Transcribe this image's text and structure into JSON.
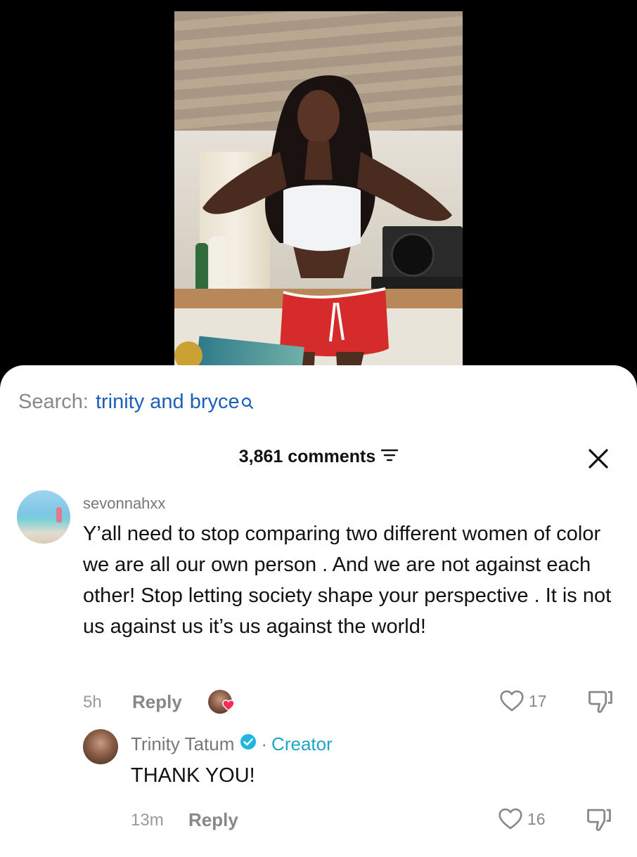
{
  "search": {
    "prefix": "Search:",
    "term": "trinity and bryce"
  },
  "comments_header": {
    "count_label": "3,861 comments"
  },
  "comments": [
    {
      "username": "sevonnahxx",
      "text": "Y’all need to stop comparing two different women of color we are all our own person . And we are not against each other! Stop letting society shape your perspective . It is not us against us it’s us against the world!",
      "time": "5h",
      "reply_label": "Reply",
      "likes": "17"
    }
  ],
  "creator_reply": {
    "name": "Trinity Tatum",
    "separator": "·",
    "badge": "Creator",
    "text": "THANK YOU!",
    "time": "13m",
    "reply_label": "Reply",
    "likes": "16"
  },
  "icons": {
    "search": "search-icon",
    "sort": "sort-icon",
    "close": "close-icon",
    "like": "heart-outline-icon",
    "dislike": "thumbs-down-icon",
    "verified": "verified-check-icon",
    "creator_liked": "heart-badge-icon"
  },
  "colors": {
    "search_term": "#1c5fb8",
    "creator_badge": "#1fa5c4",
    "verified": "#20b4e0",
    "heart_badge": "#fe2c55"
  }
}
